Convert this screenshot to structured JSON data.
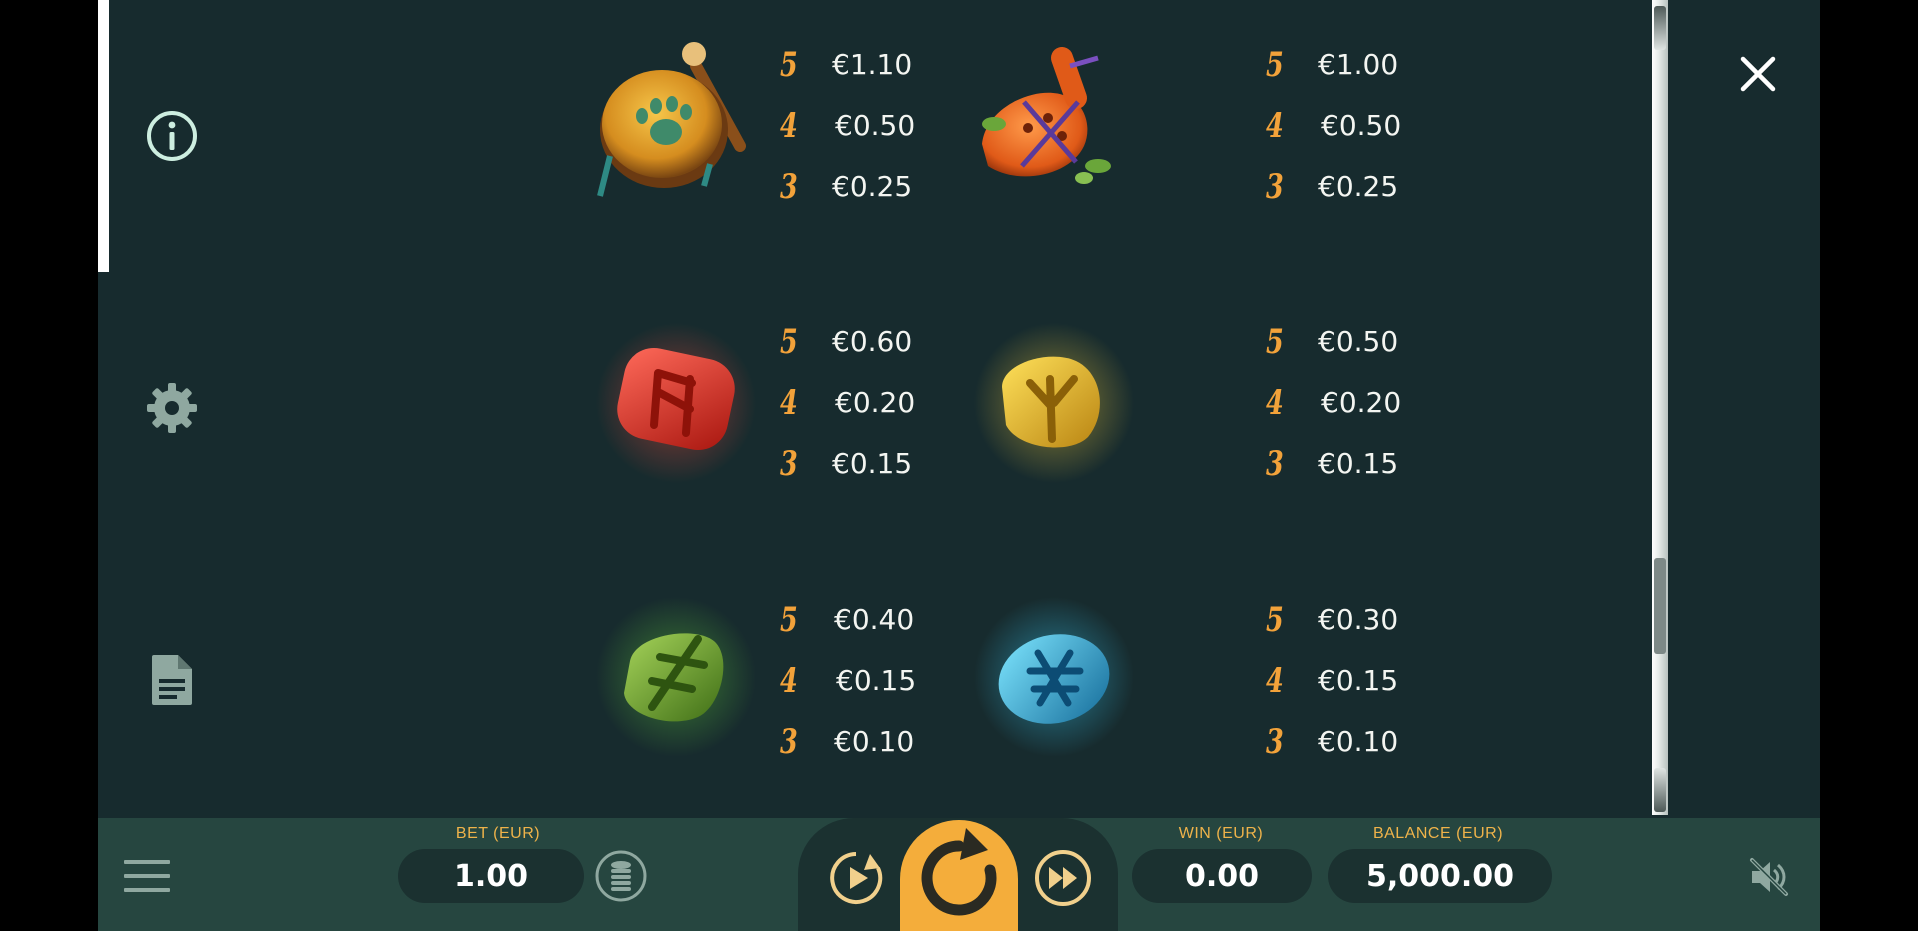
{
  "paytable": [
    {
      "symbol": "drum-symbol",
      "pays": [
        {
          "count": "5",
          "value": "€1.10"
        },
        {
          "count": "4",
          "value": "€0.50"
        },
        {
          "count": "3",
          "value": "€0.25"
        }
      ]
    },
    {
      "symbol": "ocarina-symbol",
      "pays": [
        {
          "count": "5",
          "value": "€1.00"
        },
        {
          "count": "4",
          "value": "€0.50"
        },
        {
          "count": "3",
          "value": "€0.25"
        }
      ]
    },
    {
      "symbol": "red-rune-symbol",
      "pays": [
        {
          "count": "5",
          "value": "€0.60"
        },
        {
          "count": "4",
          "value": "€0.20"
        },
        {
          "count": "3",
          "value": "€0.15"
        }
      ]
    },
    {
      "symbol": "yellow-rune-symbol",
      "pays": [
        {
          "count": "5",
          "value": "€0.50"
        },
        {
          "count": "4",
          "value": "€0.20"
        },
        {
          "count": "3",
          "value": "€0.15"
        }
      ]
    },
    {
      "symbol": "green-rune-symbol",
      "pays": [
        {
          "count": "5",
          "value": "€0.40"
        },
        {
          "count": "4",
          "value": "€0.15"
        },
        {
          "count": "3",
          "value": "€0.10"
        }
      ]
    },
    {
      "symbol": "blue-rune-symbol",
      "pays": [
        {
          "count": "5",
          "value": "€0.30"
        },
        {
          "count": "4",
          "value": "€0.15"
        },
        {
          "count": "3",
          "value": "€0.10"
        }
      ]
    }
  ],
  "sidebar": {
    "icons": [
      "info-icon",
      "settings-gear-icon",
      "document-icon"
    ]
  },
  "bottom_bar": {
    "bet_label": "BET (EUR)",
    "bet_value": "1.00",
    "win_label": "WIN (EUR)",
    "win_value": "0.00",
    "balance_label": "BALANCE (EUR)",
    "balance_value": "5,000.00"
  },
  "colors": {
    "background": "#172b2e",
    "bar": "#264640",
    "accent_gold": "#f2a23a",
    "spin_button": "#f4ad3b",
    "icon_mint": "#cdeee0"
  }
}
